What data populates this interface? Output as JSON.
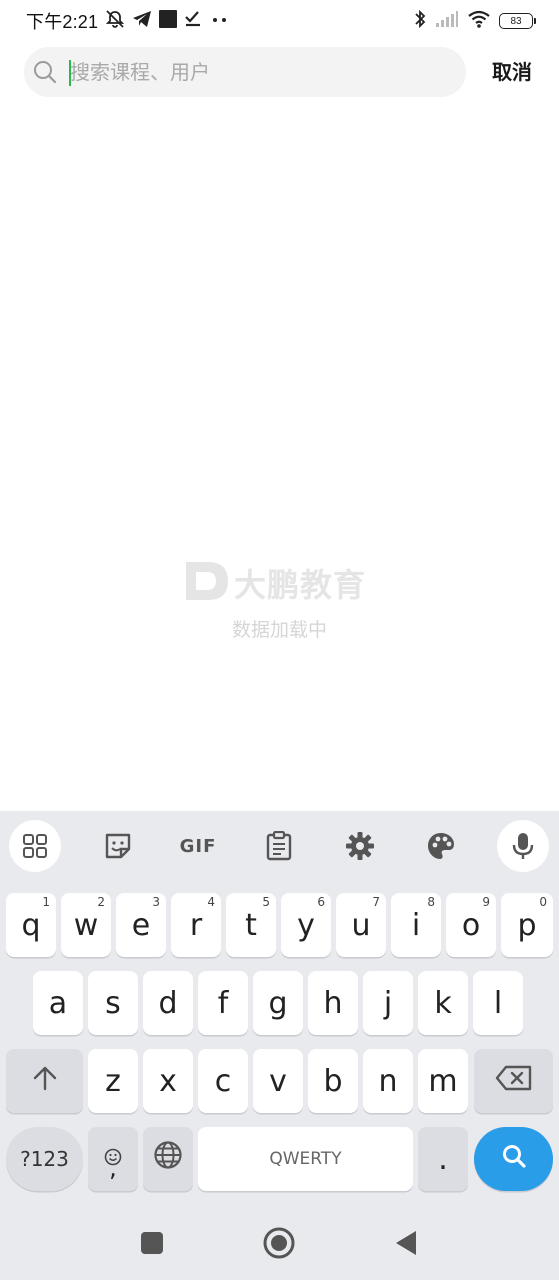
{
  "status_bar": {
    "time": "下午2:21",
    "left_icons": [
      "bell-off-icon",
      "telegram-icon",
      "square-icon",
      "checkmark-icon",
      "more-dots-icon"
    ],
    "right_icons": [
      "bluetooth-icon",
      "signal-icon",
      "wifi-icon",
      "battery-icon"
    ],
    "battery_level": "83"
  },
  "search": {
    "placeholder": "搜索课程、用户",
    "value": "",
    "cancel_label": "取消"
  },
  "loading": {
    "brand_name": "大鹏教育",
    "message": "数据加载中"
  },
  "keyboard": {
    "toolbar_icons": [
      "apps-grid-icon",
      "sticker-icon",
      "gif-icon",
      "clipboard-icon",
      "settings-gear-icon",
      "palette-icon",
      "microphone-icon"
    ],
    "gif_label": "GIF",
    "row1": [
      {
        "letter": "q",
        "hint": "1"
      },
      {
        "letter": "w",
        "hint": "2"
      },
      {
        "letter": "e",
        "hint": "3"
      },
      {
        "letter": "r",
        "hint": "4"
      },
      {
        "letter": "t",
        "hint": "5"
      },
      {
        "letter": "y",
        "hint": "6"
      },
      {
        "letter": "u",
        "hint": "7"
      },
      {
        "letter": "i",
        "hint": "8"
      },
      {
        "letter": "o",
        "hint": "9"
      },
      {
        "letter": "p",
        "hint": "0"
      }
    ],
    "row2": [
      "a",
      "s",
      "d",
      "f",
      "g",
      "h",
      "j",
      "k",
      "l"
    ],
    "row3": [
      "z",
      "x",
      "c",
      "v",
      "b",
      "n",
      "m"
    ],
    "symbols_label": "?123",
    "comma_label": ",",
    "space_label": "QWERTY",
    "period_label": "."
  },
  "nav": {
    "icons": [
      "recents-square-icon",
      "home-circle-icon",
      "back-triangle-icon"
    ]
  }
}
